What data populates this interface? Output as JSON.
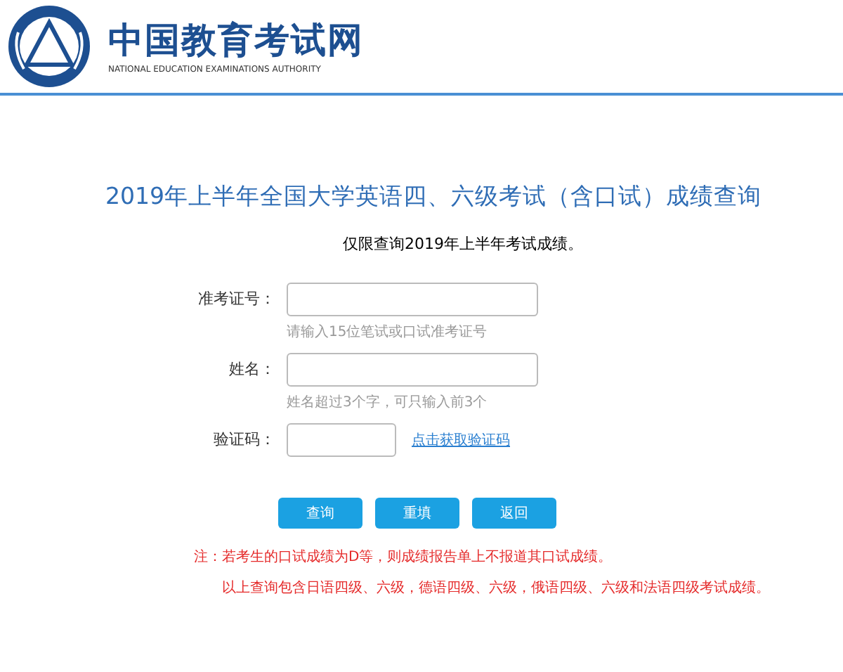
{
  "header": {
    "site_name": "中国教育考试网",
    "site_name_en": "NATIONAL EDUCATION EXAMINATIONS AUTHORITY"
  },
  "title": "2019年上半年全国大学英语四、六级考试（含口试）成绩查询",
  "subtitle": "仅限查询2019年上半年考试成绩。",
  "fields": [
    {
      "kind": "wide",
      "label": "准考证号：",
      "hint": "请输入15位笔试或口试准考证号"
    },
    {
      "kind": "wide",
      "label": "姓名：",
      "hint": "姓名超过3个字，可只输入前3个"
    },
    {
      "kind": "captcha",
      "label": "验证码：",
      "link": "点击获取验证码"
    }
  ],
  "buttons": [
    "查询",
    "重填",
    "返回"
  ],
  "notes": [
    "注：若考生的口试成绩为D等，则成绩报告单上不报道其口试成绩。",
    "以上查询包含日语四级、六级，德语四级、六级，俄语四级、六级和法语四级考试成绩。"
  ]
}
